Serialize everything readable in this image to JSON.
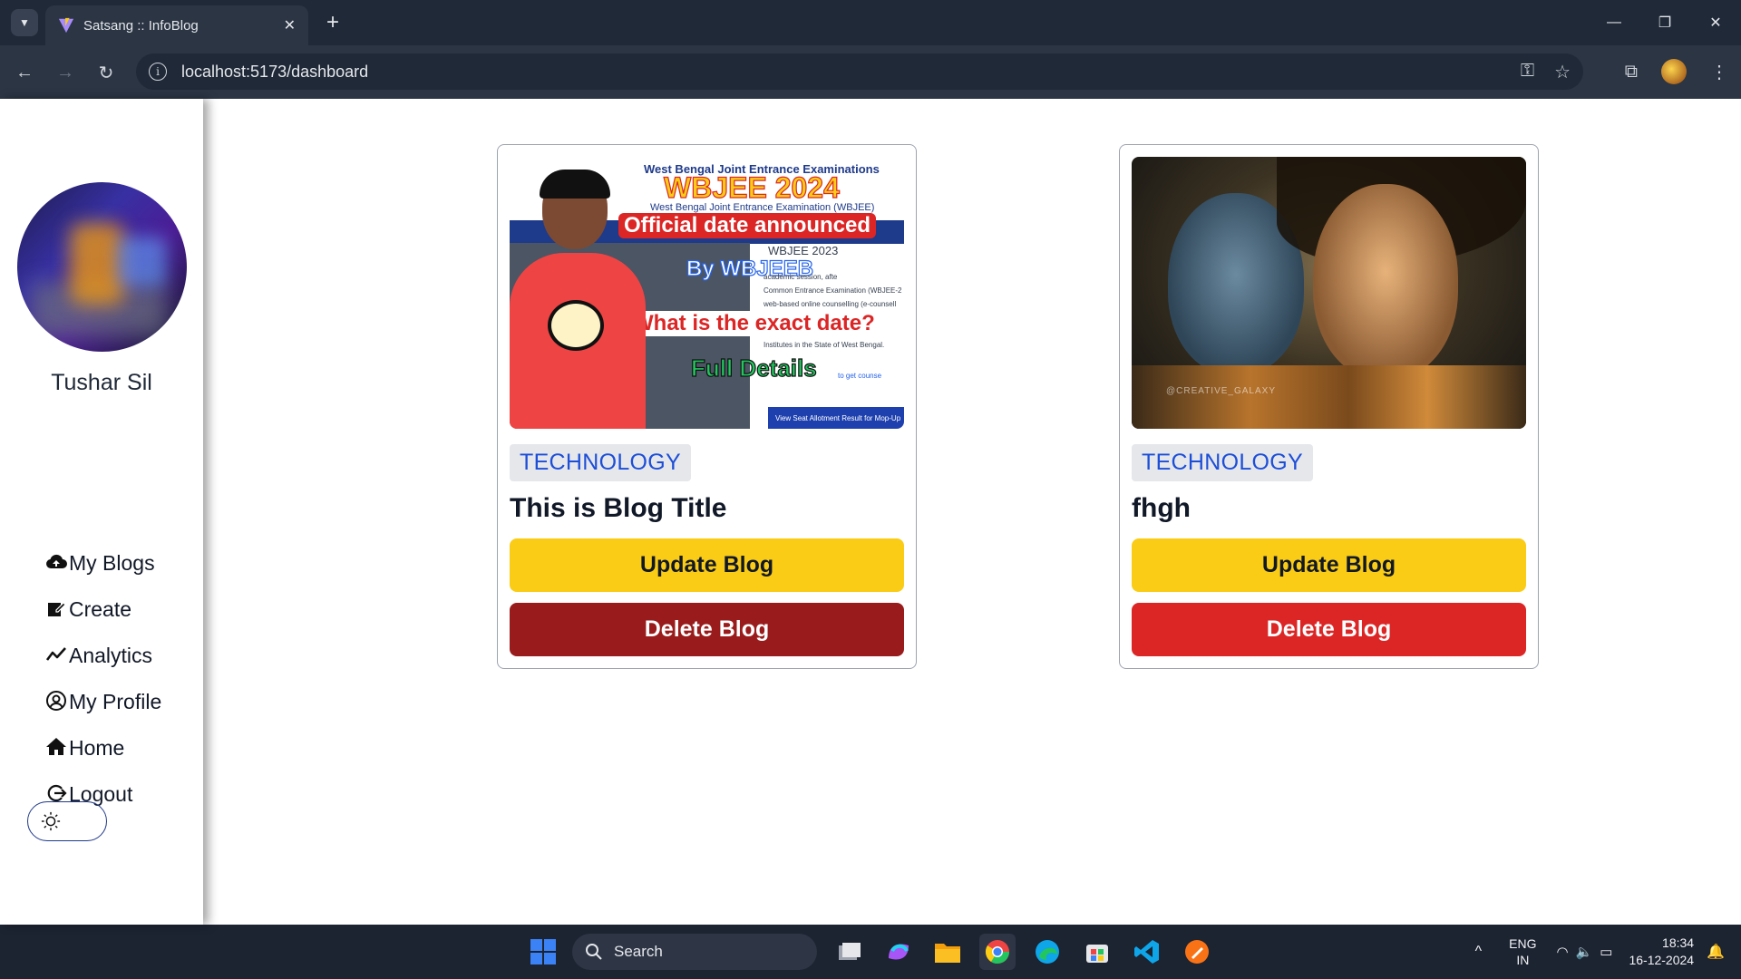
{
  "browser": {
    "tab_title": "Satsang :: InfoBlog",
    "new_tab": "+",
    "url": "localhost:5173/dashboard"
  },
  "sidebar": {
    "user_name": "Tushar Sil",
    "menu": [
      {
        "label": "My Blogs",
        "icon": "cloud-upload-icon"
      },
      {
        "label": "Create",
        "icon": "edit-icon"
      },
      {
        "label": "Analytics",
        "icon": "trend-icon"
      },
      {
        "label": "My Profile",
        "icon": "user-circle-icon"
      },
      {
        "label": "Home",
        "icon": "home-icon"
      },
      {
        "label": "Logout",
        "icon": "logout-icon"
      }
    ],
    "theme_toggle_icon": "sun-icon"
  },
  "thumbnail1": {
    "header": "West Bengal Joint Entrance Examinations",
    "wbjee": "WBJEE 2024",
    "sub": "West Bengal Joint Entrance Examination (WBJEE)",
    "official": "Official date announced",
    "by": "By WBJEEB",
    "wbjee2023": "WBJEE 2023",
    "question": "What is the exact date?",
    "full": "Full Details",
    "small1": "academic session, afte",
    "small2": "Common Entrance Examination (WBJEE-2",
    "small3": "web-based online counselling (e-counsell",
    "small4": "Institutes in the State of West Bengal.",
    "link": "to get counse",
    "footer": "View Seat Allotment Result for Mop-Up"
  },
  "thumbnail2": {
    "watermark": "@CREATIVE_GALAXY"
  },
  "blogs": [
    {
      "category": "TECHNOLOGY",
      "title": "This is Blog Title",
      "update_label": "Update Blog",
      "delete_label": "Delete Blog",
      "delete_color": "#991b1b"
    },
    {
      "category": "TECHNOLOGY",
      "title": "fhgh",
      "update_label": "Update Blog",
      "delete_label": "Delete Blog",
      "delete_color": "#dc2626"
    }
  ],
  "taskbar": {
    "search_label": "Search",
    "lang": "ENG",
    "region": "IN",
    "time": "18:34",
    "date": "16-12-2024"
  },
  "colors": {
    "update_button": "#facc15",
    "category_text": "#1d4ed8"
  }
}
